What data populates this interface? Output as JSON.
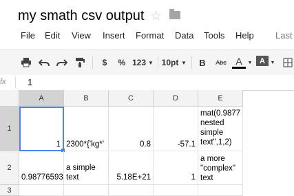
{
  "document": {
    "title": "my smath csv output"
  },
  "menu": [
    "File",
    "Edit",
    "View",
    "Insert",
    "Format",
    "Data",
    "Tools",
    "Help",
    "Last"
  ],
  "toolbar": {
    "currency": "$",
    "percent": "%",
    "number_format": "123",
    "font_size": "10pt",
    "bold": "B",
    "strikethrough": "Abc",
    "text_color": "A",
    "fill_color": "A"
  },
  "formula_bar": {
    "label": "fx",
    "value": "1"
  },
  "columns": [
    "A",
    "B",
    "C",
    "D",
    "E"
  ],
  "rows": [
    "1",
    "2",
    "3"
  ],
  "cells": {
    "A1": "1",
    "B1": "2300*{'kg*'",
    "C1": "0.8",
    "D1": "-57.1",
    "E1": [
      "mat(0.9877",
      "nested",
      "simple",
      "text\",1,2)"
    ],
    "A2": "0.98776593",
    "B2": [
      "a simple",
      "text"
    ],
    "C2": "5.18E+21",
    "D2": "1",
    "E2": [
      "a more",
      "\"complex\"",
      "text"
    ]
  },
  "colors": {
    "selection": "#4a86e8",
    "header_selected": "#d3d3d3"
  }
}
